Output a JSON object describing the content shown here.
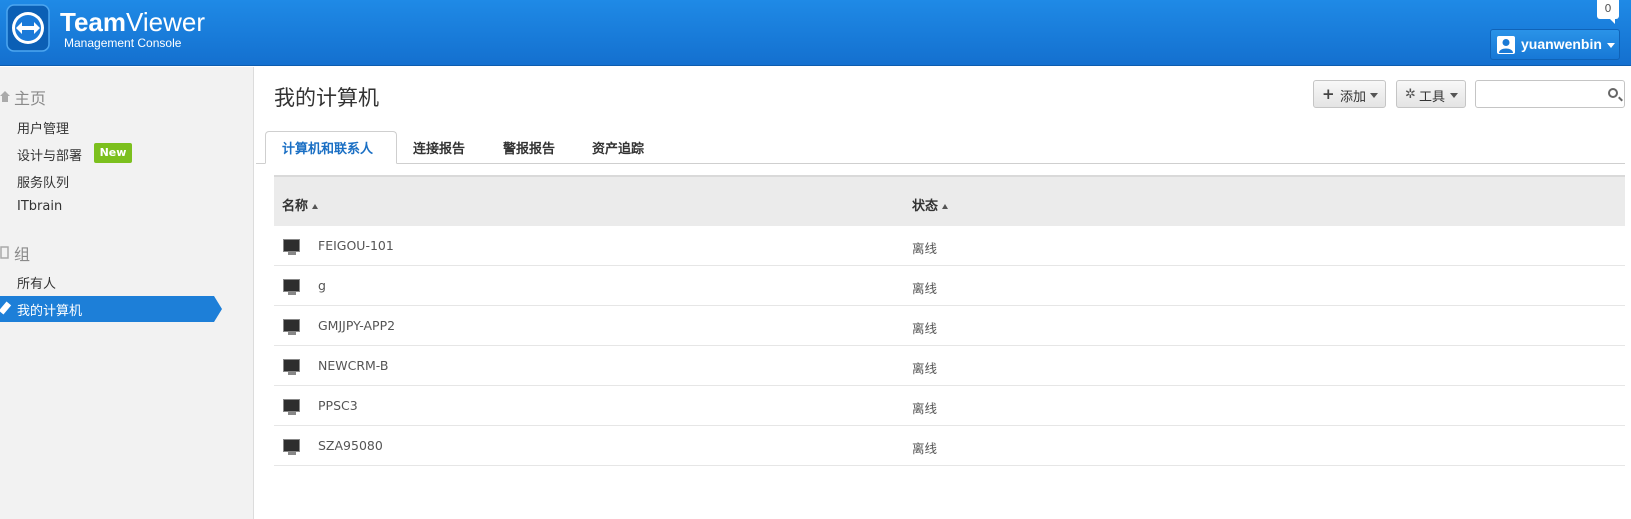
{
  "header": {
    "brand_bold": "Team",
    "brand_light": "Viewer",
    "brand_sub": "Management Console",
    "notification_count": "0",
    "user_name": "yuanwenbin"
  },
  "sidebar": {
    "home_heading": "主页",
    "items_home": [
      {
        "label": "用户管理"
      },
      {
        "label": "设计与部署",
        "badge": "New"
      },
      {
        "label": "服务队列"
      },
      {
        "label": "ITbrain"
      }
    ],
    "group_heading": "组",
    "items_group": [
      {
        "label": "所有人"
      },
      {
        "label": "我的计算机",
        "active": true
      }
    ]
  },
  "main": {
    "title": "我的计算机",
    "add_button": "添加",
    "tools_button": "工具",
    "search_placeholder": "",
    "tabs": [
      {
        "label": "计算机和联系人",
        "active": true
      },
      {
        "label": "连接报告"
      },
      {
        "label": "警报报告"
      },
      {
        "label": "资产追踪"
      }
    ],
    "table": {
      "columns": [
        "名称",
        "状态"
      ],
      "rows": [
        {
          "name": "FEIGOU-101",
          "status": "离线"
        },
        {
          "name": "g",
          "status": "离线"
        },
        {
          "name": "GMJJPY-APP2",
          "status": "离线"
        },
        {
          "name": "NEWCRM-B",
          "status": "离线"
        },
        {
          "name": "PPSC3",
          "status": "离线"
        },
        {
          "name": "SZA95080",
          "status": "离线"
        }
      ]
    }
  },
  "colors": {
    "header_blue": "#1470cf",
    "active_blue": "#1d7fd8",
    "new_badge_green": "#7cc01e"
  }
}
